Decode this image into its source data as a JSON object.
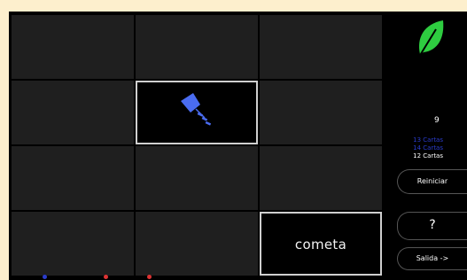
{
  "game": {
    "revealed_word": "cometa",
    "revealed_image": "kite-icon",
    "turns": "9",
    "scores": [
      {
        "label": "13 Cartas",
        "color": "#2a3ccc"
      },
      {
        "label": "14 Cartas",
        "color": "#2a3ccc"
      },
      {
        "label": "12 Cartas",
        "color": "#ffffff"
      }
    ]
  },
  "controls": {
    "restart_label": "Reiniciar",
    "help_label": "?",
    "exit_label": "Salida ->"
  },
  "icons": {
    "leaf": "leaf-icon",
    "kite": "kite-icon"
  },
  "colors": {
    "background": "#fdefcd",
    "leaf": "#2ecc40",
    "kite": "#4a6cf0",
    "card": "#1f1f1f"
  }
}
